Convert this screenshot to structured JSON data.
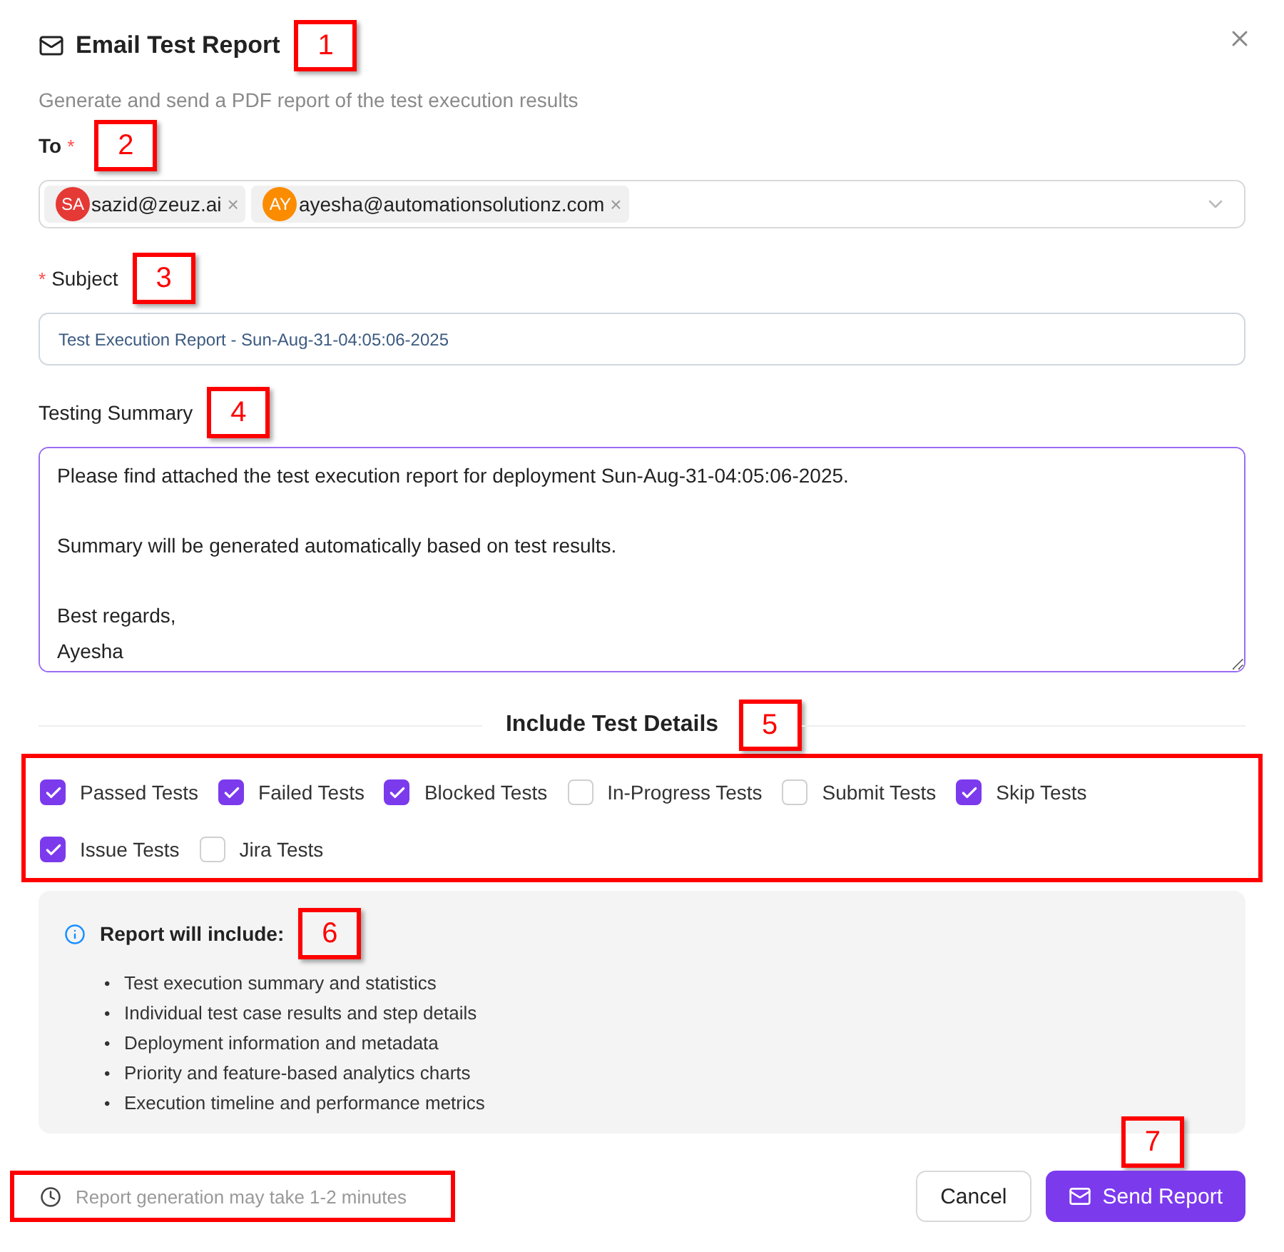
{
  "dialog": {
    "title": "Email Test Report",
    "title_marker": "1",
    "subtitle": "Generate and send a PDF report of the test execution results"
  },
  "to": {
    "label": "To",
    "required_mark": "*",
    "marker": "2",
    "recipients": [
      {
        "initials": "SA",
        "email": "sazid@zeuz.ai",
        "remove": "×",
        "color": "#e53935"
      },
      {
        "initials": "AY",
        "email": "ayesha@automationsolutionz.com",
        "remove": "×",
        "color": "#fb8c00"
      }
    ]
  },
  "subject": {
    "required_mark": "*",
    "label": "Subject",
    "marker": "3",
    "value": "Test Execution Report - Sun-Aug-31-04:05:06-2025"
  },
  "summary": {
    "label": "Testing Summary",
    "marker": "4",
    "paragraphs": [
      [
        "Please find attached the test execution report for deployment Sun-Aug-31-04:05:06-2025."
      ],
      [
        "Summary will be generated automatically based on test results."
      ],
      [
        "Best regards,",
        "Ayesha"
      ]
    ]
  },
  "details": {
    "heading": "Include Test Details",
    "marker": "5",
    "outlined": true,
    "options": [
      {
        "label": "Passed Tests",
        "checked": true
      },
      {
        "label": "Failed Tests",
        "checked": true
      },
      {
        "label": "Blocked Tests",
        "checked": true
      },
      {
        "label": "In-Progress Tests",
        "checked": false
      },
      {
        "label": "Submit Tests",
        "checked": false
      },
      {
        "label": "Skip Tests",
        "checked": true
      },
      {
        "label": "Issue Tests",
        "checked": true
      },
      {
        "label": "Jira Tests",
        "checked": false
      }
    ]
  },
  "info": {
    "title": "Report will include:",
    "marker": "6",
    "bullet": "•",
    "items": [
      "Test execution summary and statistics",
      "Individual test case results and step details",
      "Deployment information and metadata",
      "Priority and feature-based analytics charts",
      "Execution timeline and performance metrics"
    ]
  },
  "footer": {
    "hint": "Report generation may take 1-2 minutes",
    "hint_outlined": true,
    "marker": "7",
    "buttons": [
      {
        "kind": "secondary",
        "label": "Cancel"
      },
      {
        "kind": "primary",
        "label": "Send Report"
      }
    ]
  }
}
